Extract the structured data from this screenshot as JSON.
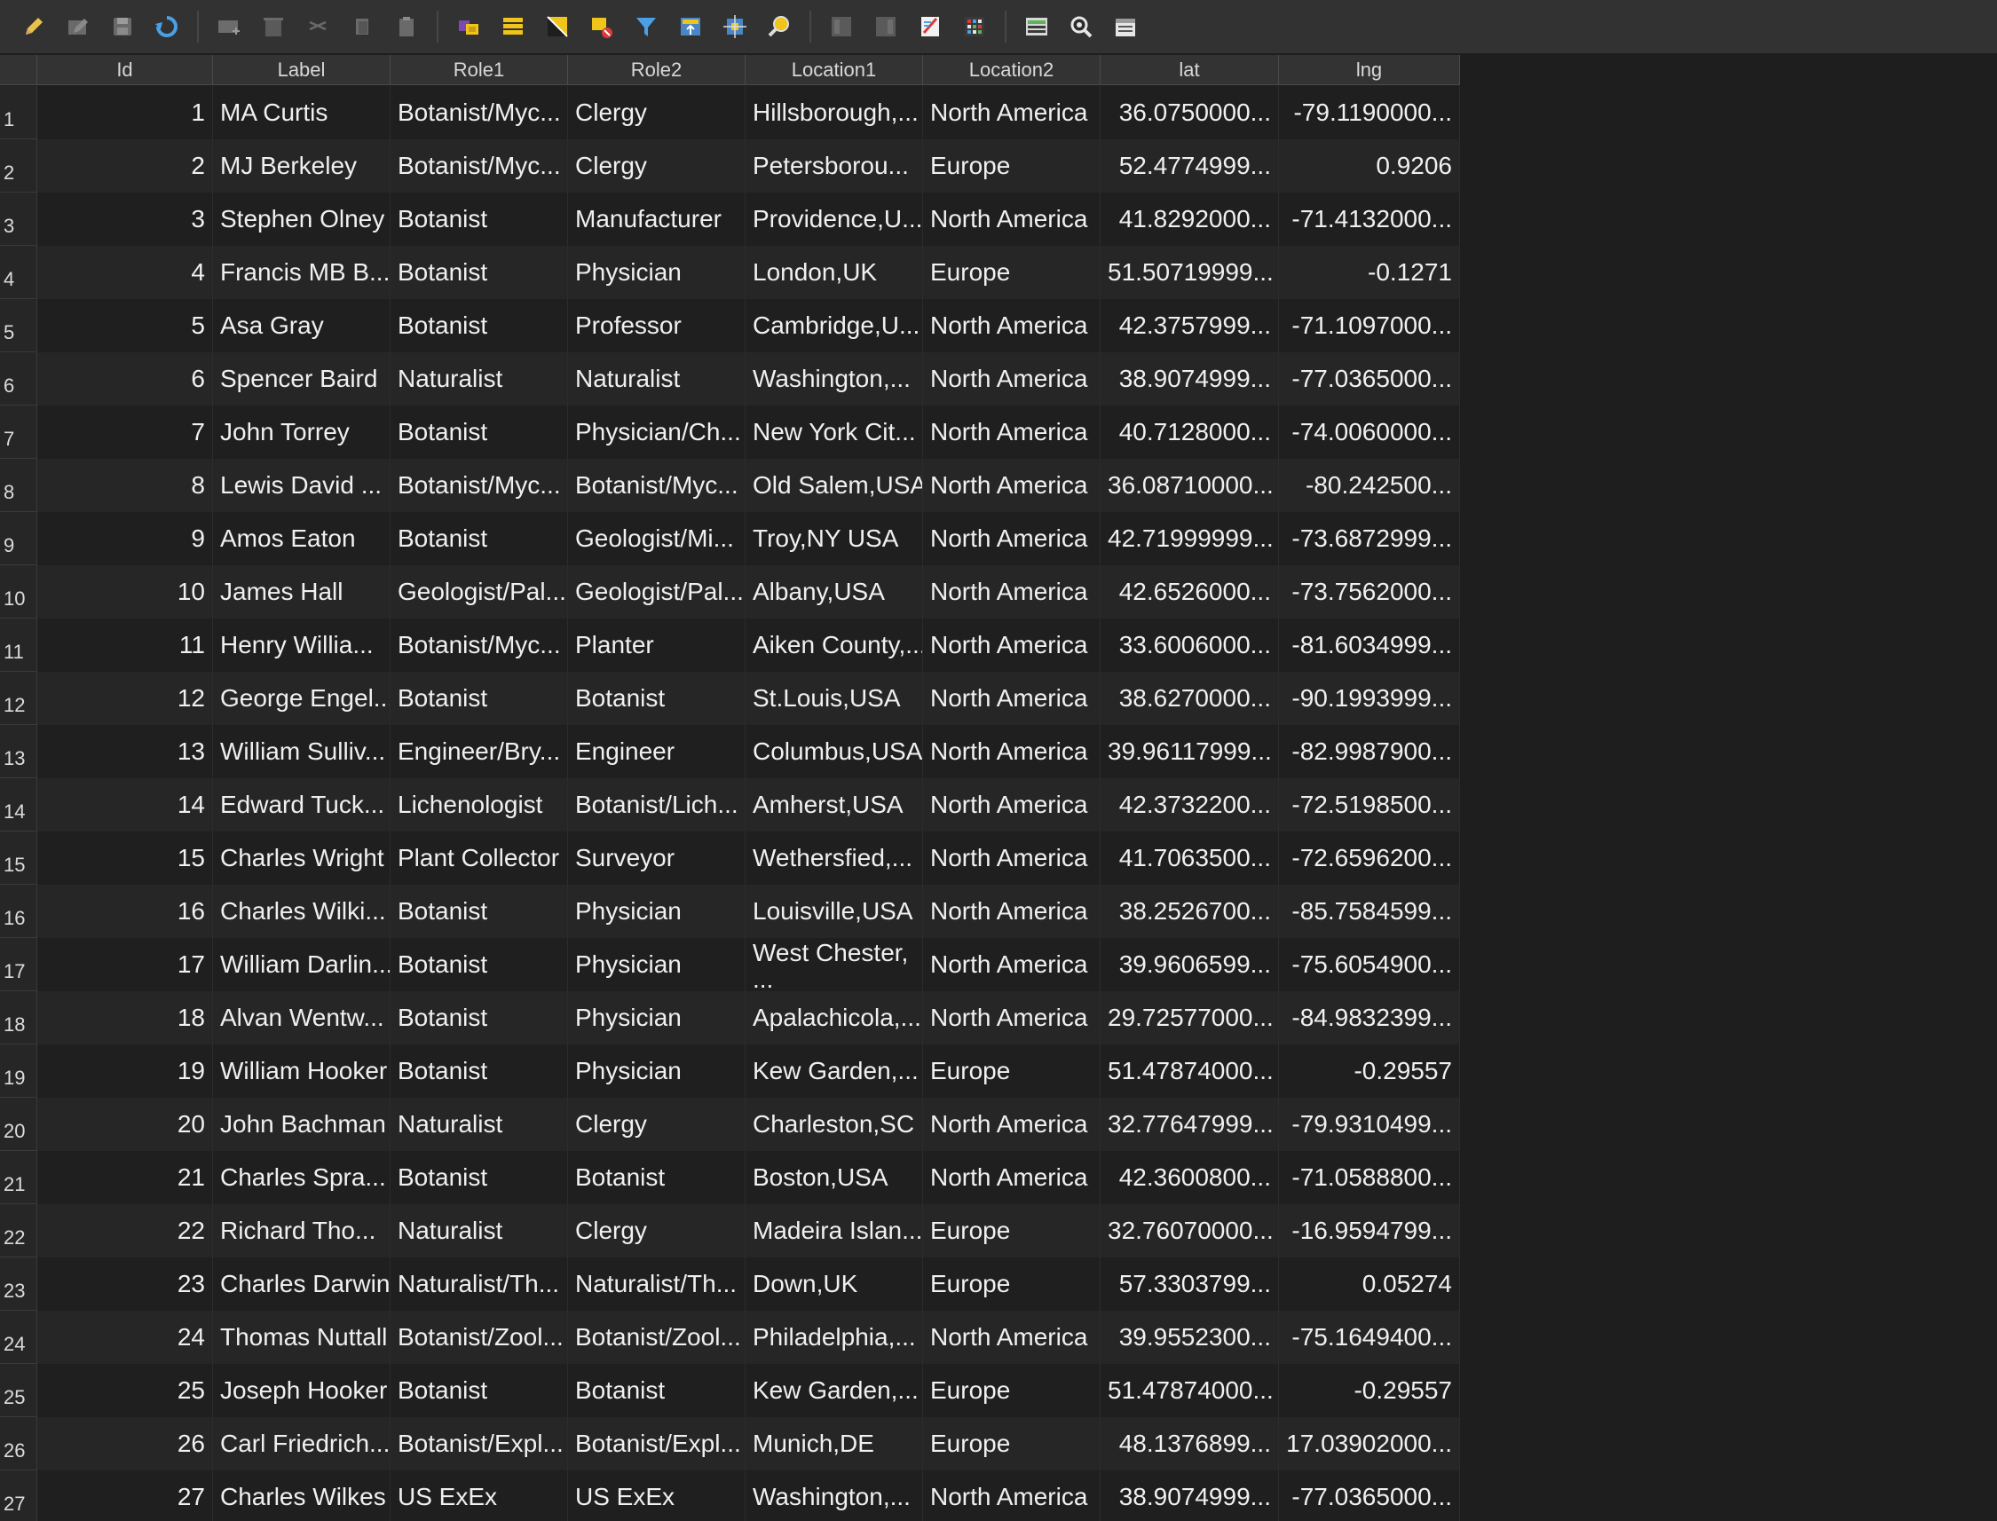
{
  "toolbar": {
    "icons": [
      "edit-pencil-icon",
      "multi-edit-icon",
      "save-edits-icon",
      "reload-icon",
      "add-feature-icon",
      "delete-feature-icon",
      "cut-icon",
      "copy-icon",
      "paste-icon",
      "select-expression-icon",
      "select-all-icon",
      "invert-selection-icon",
      "deselect-icon",
      "filter-icon",
      "move-selection-top-icon",
      "pan-to-selection-icon",
      "zoom-to-selection-icon",
      "new-field-icon",
      "delete-field-icon",
      "field-calculator-icon",
      "conditional-format-icon",
      "dock-icon",
      "actions-icon",
      "form-view-icon"
    ]
  },
  "table": {
    "columns": [
      "Id",
      "Label",
      "Role1",
      "Role2",
      "Location1",
      "Location2",
      "lat",
      "lng"
    ],
    "rows": [
      {
        "n": "1",
        "id": "1",
        "label": "MA Curtis",
        "role1": "Botanist/Myc...",
        "role2": "Clergy",
        "loc1": "Hillsborough,...",
        "loc2": "North America",
        "lat": "36.0750000...",
        "lng": "-79.1190000..."
      },
      {
        "n": "2",
        "id": "2",
        "label": "MJ Berkeley",
        "role1": "Botanist/Myc...",
        "role2": "Clergy",
        "loc1": "Petersborou...",
        "loc2": "Europe",
        "lat": "52.4774999...",
        "lng": "0.9206"
      },
      {
        "n": "3",
        "id": "3",
        "label": "Stephen Olney",
        "role1": "Botanist",
        "role2": "Manufacturer",
        "loc1": "Providence,U...",
        "loc2": "North America",
        "lat": "41.8292000...",
        "lng": "-71.4132000..."
      },
      {
        "n": "4",
        "id": "4",
        "label": "Francis MB B...",
        "role1": "Botanist",
        "role2": "Physician",
        "loc1": "London,UK",
        "loc2": "Europe",
        "lat": "51.50719999...",
        "lng": "-0.1271"
      },
      {
        "n": "5",
        "id": "5",
        "label": "Asa Gray",
        "role1": "Botanist",
        "role2": "Professor",
        "loc1": "Cambridge,U...",
        "loc2": "North America",
        "lat": "42.3757999...",
        "lng": "-71.1097000..."
      },
      {
        "n": "6",
        "id": "6",
        "label": "Spencer Baird",
        "role1": "Naturalist",
        "role2": "Naturalist",
        "loc1": "Washington,...",
        "loc2": "North America",
        "lat": "38.9074999...",
        "lng": "-77.0365000..."
      },
      {
        "n": "7",
        "id": "7",
        "label": "John Torrey",
        "role1": "Botanist",
        "role2": "Physician/Ch...",
        "loc1": "New York Cit...",
        "loc2": "North America",
        "lat": "40.7128000...",
        "lng": "-74.0060000..."
      },
      {
        "n": "8",
        "id": "8",
        "label": "Lewis David ...",
        "role1": "Botanist/Myc...",
        "role2": "Botanist/Myc...",
        "loc1": "Old Salem,USA",
        "loc2": "North America",
        "lat": "36.08710000...",
        "lng": "-80.242500..."
      },
      {
        "n": "9",
        "id": "9",
        "label": "Amos Eaton",
        "role1": "Botanist",
        "role2": "Geologist/Mi...",
        "loc1": "Troy,NY USA",
        "loc2": "North America",
        "lat": "42.71999999...",
        "lng": "-73.6872999..."
      },
      {
        "n": "10",
        "id": "10",
        "label": "James Hall",
        "role1": "Geologist/Pal...",
        "role2": "Geologist/Pal...",
        "loc1": "Albany,USA",
        "loc2": "North America",
        "lat": "42.6526000...",
        "lng": "-73.7562000..."
      },
      {
        "n": "11",
        "id": "11",
        "label": "Henry Willia...",
        "role1": "Botanist/Myc...",
        "role2": "Planter",
        "loc1": "Aiken County,...",
        "loc2": "North America",
        "lat": "33.6006000...",
        "lng": "-81.6034999..."
      },
      {
        "n": "12",
        "id": "12",
        "label": "George Engel...",
        "role1": "Botanist",
        "role2": "Botanist",
        "loc1": "St.Louis,USA",
        "loc2": "North America",
        "lat": "38.6270000...",
        "lng": "-90.1993999..."
      },
      {
        "n": "13",
        "id": "13",
        "label": "William Sulliv...",
        "role1": "Engineer/Bry...",
        "role2": "Engineer",
        "loc1": "Columbus,USA",
        "loc2": "North America",
        "lat": "39.96117999...",
        "lng": "-82.9987900..."
      },
      {
        "n": "14",
        "id": "14",
        "label": "Edward Tuck...",
        "role1": "Lichenologist",
        "role2": "Botanist/Lich...",
        "loc1": "Amherst,USA",
        "loc2": "North America",
        "lat": "42.3732200...",
        "lng": "-72.5198500..."
      },
      {
        "n": "15",
        "id": "15",
        "label": "Charles Wright",
        "role1": "Plant Collector",
        "role2": "Surveyor",
        "loc1": "Wethersfied,...",
        "loc2": "North America",
        "lat": "41.7063500...",
        "lng": "-72.6596200..."
      },
      {
        "n": "16",
        "id": "16",
        "label": "Charles Wilki...",
        "role1": "Botanist",
        "role2": "Physician",
        "loc1": "Louisville,USA",
        "loc2": "North America",
        "lat": "38.2526700...",
        "lng": "-85.7584599..."
      },
      {
        "n": "17",
        "id": "17",
        "label": "William Darlin...",
        "role1": "Botanist",
        "role2": "Physician",
        "loc1": "West Chester, ...",
        "loc2": "North America",
        "lat": "39.9606599...",
        "lng": "-75.6054900..."
      },
      {
        "n": "18",
        "id": "18",
        "label": "Alvan Wentw...",
        "role1": "Botanist",
        "role2": "Physician",
        "loc1": "Apalachicola,...",
        "loc2": "North America",
        "lat": "29.72577000...",
        "lng": "-84.9832399..."
      },
      {
        "n": "19",
        "id": "19",
        "label": "William Hooker",
        "role1": "Botanist",
        "role2": "Physician",
        "loc1": "Kew Garden,...",
        "loc2": "Europe",
        "lat": "51.47874000...",
        "lng": "-0.29557"
      },
      {
        "n": "20",
        "id": "20",
        "label": "John Bachman",
        "role1": "Naturalist",
        "role2": "Clergy",
        "loc1": "Charleston,SC",
        "loc2": "North America",
        "lat": "32.77647999...",
        "lng": "-79.9310499..."
      },
      {
        "n": "21",
        "id": "21",
        "label": "Charles Spra...",
        "role1": "Botanist",
        "role2": "Botanist",
        "loc1": "Boston,USA",
        "loc2": "North America",
        "lat": "42.3600800...",
        "lng": "-71.0588800..."
      },
      {
        "n": "22",
        "id": "22",
        "label": "Richard Tho...",
        "role1": "Naturalist",
        "role2": "Clergy",
        "loc1": "Madeira Islan...",
        "loc2": "Europe",
        "lat": "32.76070000...",
        "lng": "-16.9594799..."
      },
      {
        "n": "23",
        "id": "23",
        "label": "Charles Darwin",
        "role1": "Naturalist/Th...",
        "role2": "Naturalist/Th...",
        "loc1": "Down,UK",
        "loc2": "Europe",
        "lat": "57.3303799...",
        "lng": "0.05274"
      },
      {
        "n": "24",
        "id": "24",
        "label": "Thomas Nuttall",
        "role1": "Botanist/Zool...",
        "role2": "Botanist/Zool...",
        "loc1": "Philadelphia,...",
        "loc2": "North America",
        "lat": "39.9552300...",
        "lng": "-75.1649400..."
      },
      {
        "n": "25",
        "id": "25",
        "label": "Joseph Hooker",
        "role1": "Botanist",
        "role2": "Botanist",
        "loc1": "Kew Garden,...",
        "loc2": "Europe",
        "lat": "51.47874000...",
        "lng": "-0.29557"
      },
      {
        "n": "26",
        "id": "26",
        "label": "Carl Friedrich...",
        "role1": "Botanist/Expl...",
        "role2": "Botanist/Expl...",
        "loc1": "Munich,DE",
        "loc2": "Europe",
        "lat": "48.1376899...",
        "lng": "17.03902000..."
      },
      {
        "n": "27",
        "id": "27",
        "label": "Charles Wilkes",
        "role1": "US ExEx",
        "role2": "US ExEx",
        "loc1": "Washington,...",
        "loc2": "North America",
        "lat": "38.9074999...",
        "lng": "-77.0365000..."
      }
    ]
  }
}
